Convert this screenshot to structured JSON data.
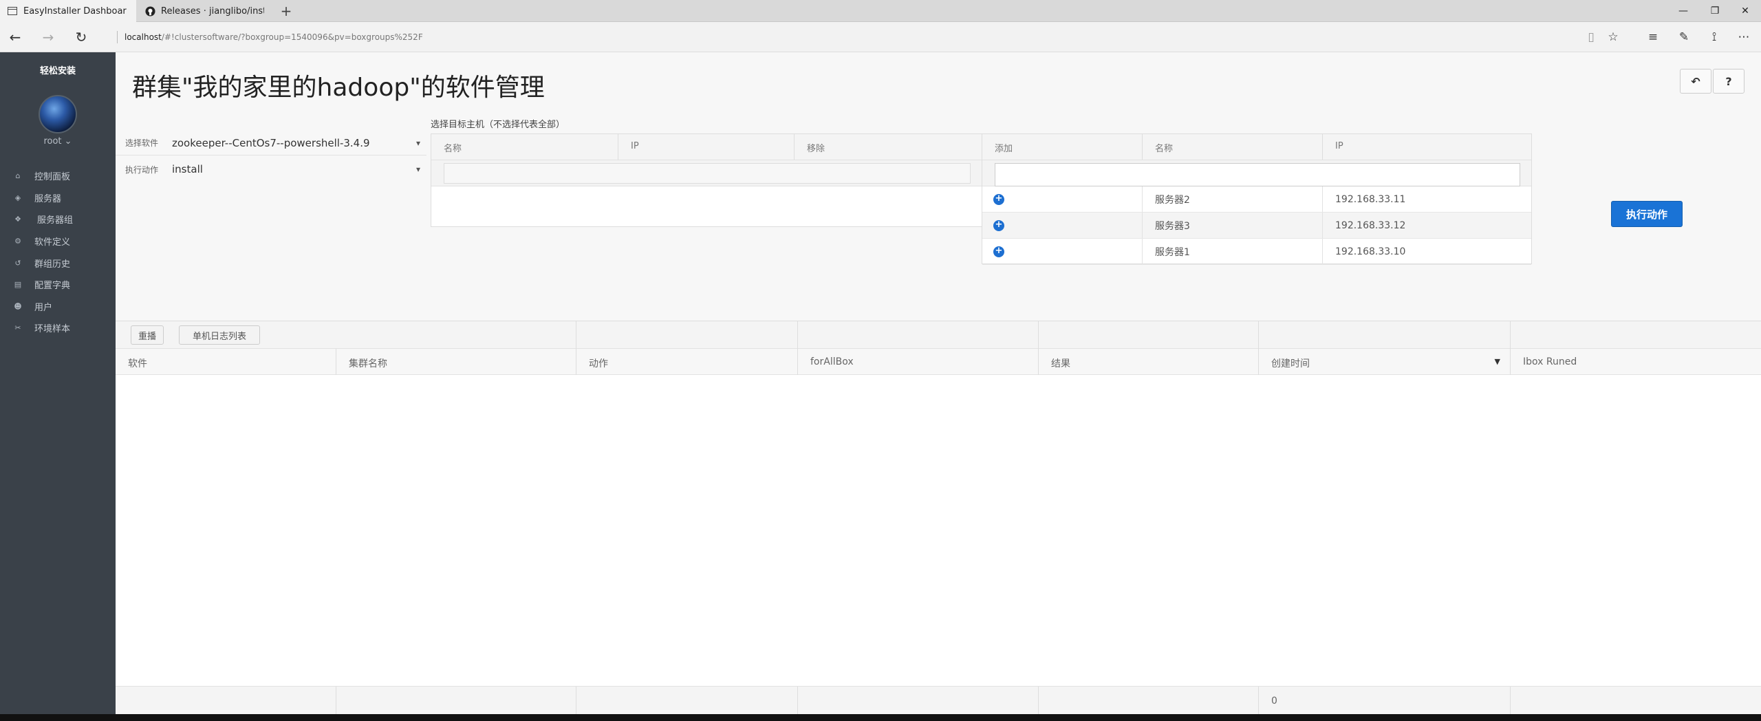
{
  "browser": {
    "tabs": [
      {
        "title": "EasyInstaller Dashboard",
        "icon": "page-icon"
      },
      {
        "title": "Releases · jianglibo/install-s",
        "icon": "github-icon"
      }
    ],
    "address": {
      "host": "localhost",
      "path": "/#!clustersoftware/?boxgroup=1540096&pv=boxgroups%252F"
    }
  },
  "sidebar": {
    "brand": "轻松安装",
    "user": "root ⌄",
    "items": [
      {
        "label": "控制面板",
        "icon": "home-icon"
      },
      {
        "label": "服务器",
        "icon": "cube-icon"
      },
      {
        "label": "服务器组",
        "icon": "cubes-icon"
      },
      {
        "label": "软件定义",
        "icon": "cogs-icon"
      },
      {
        "label": "群组历史",
        "icon": "history-icon"
      },
      {
        "label": "配置字典",
        "icon": "book-icon"
      },
      {
        "label": "用户",
        "icon": "users-icon"
      },
      {
        "label": "环境样本",
        "icon": "wrench-icon"
      }
    ]
  },
  "page": {
    "title": "群集\"我的家里的hadoop\"的软件管理",
    "software_label": "选择软件",
    "software_value": "zookeeper--CentOs7--powershell-3.4.9",
    "action_label": "执行动作",
    "action_value": "install",
    "target_label": "选择目标主机（不选择代表全部）",
    "execute_button": "执行动作"
  },
  "selected_grid": {
    "headers": [
      "名称",
      "IP",
      "移除"
    ]
  },
  "available_grid": {
    "headers": [
      "添加",
      "名称",
      "IP"
    ],
    "rows": [
      {
        "name": "服务器2",
        "ip": "192.168.33.11"
      },
      {
        "name": "服务器3",
        "ip": "192.168.33.12"
      },
      {
        "name": "服务器1",
        "ip": "192.168.33.10"
      }
    ]
  },
  "log": {
    "buttons": [
      "重播",
      "单机日志列表"
    ],
    "headers": [
      "软件",
      "集群名称",
      "动作",
      "forAllBox",
      "结果",
      "创建时间",
      "Ibox Runed"
    ],
    "footer_count": "0"
  }
}
